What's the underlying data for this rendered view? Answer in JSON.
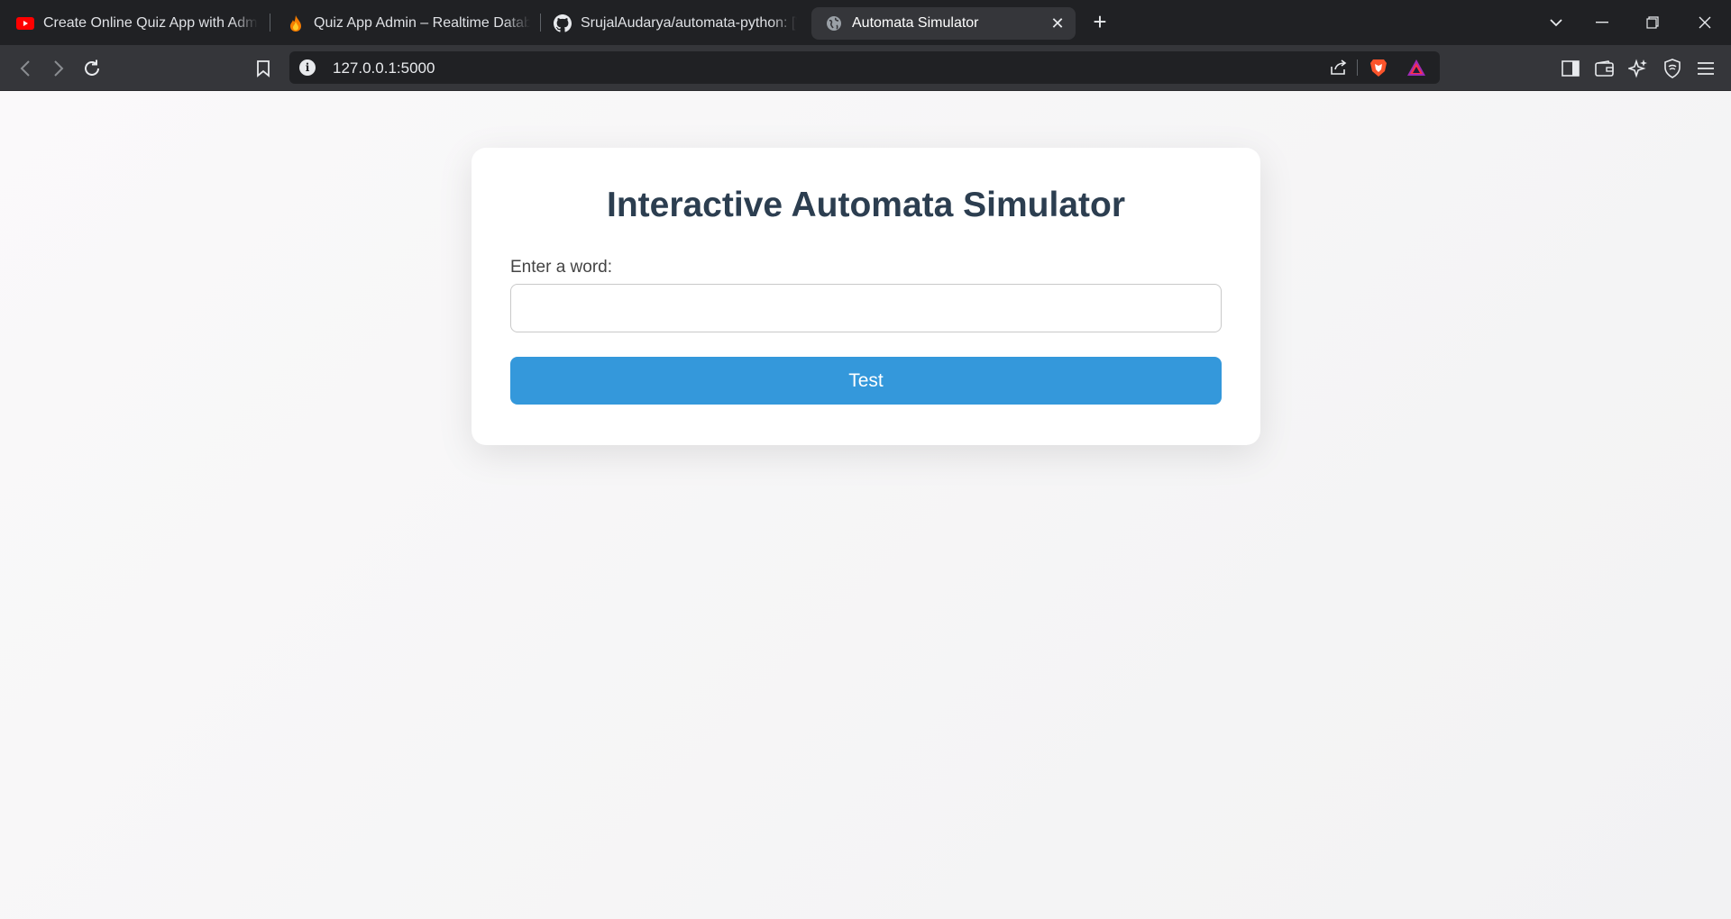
{
  "browser": {
    "tabs": [
      {
        "title": "Create Online Quiz App with Admin",
        "favicon": "youtube-icon",
        "active": false
      },
      {
        "title": "Quiz App Admin – Realtime Database",
        "favicon": "firebase-icon",
        "active": false
      },
      {
        "title": "SrujalAudarya/automata-python: [W",
        "favicon": "github-icon",
        "active": false
      },
      {
        "title": "Automata Simulator",
        "favicon": "globe-icon",
        "active": true
      }
    ],
    "url": "127.0.0.1:5000"
  },
  "page": {
    "title": "Interactive Automata Simulator",
    "input_label": "Enter a word:",
    "input_value": "",
    "input_placeholder": "",
    "button_label": "Test"
  },
  "colors": {
    "accent": "#3498db",
    "heading": "#2c3e50",
    "chrome_dark": "#202124",
    "chrome_toolbar": "#35363a"
  }
}
